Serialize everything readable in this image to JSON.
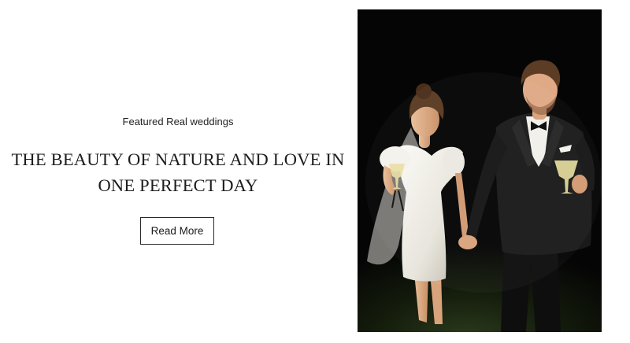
{
  "feature": {
    "eyebrow": "Featured Real weddings",
    "headline": "THE BEAUTY OF NATURE AND LOVE IN ONE PERFECT DAY",
    "cta_label": "Read More"
  },
  "photo": {
    "subject": "couple-walking-with-champagne-photo"
  },
  "colors": {
    "text": "#1a1a1a",
    "button_border": "#2a2a2a",
    "photo_background": "#050505"
  }
}
